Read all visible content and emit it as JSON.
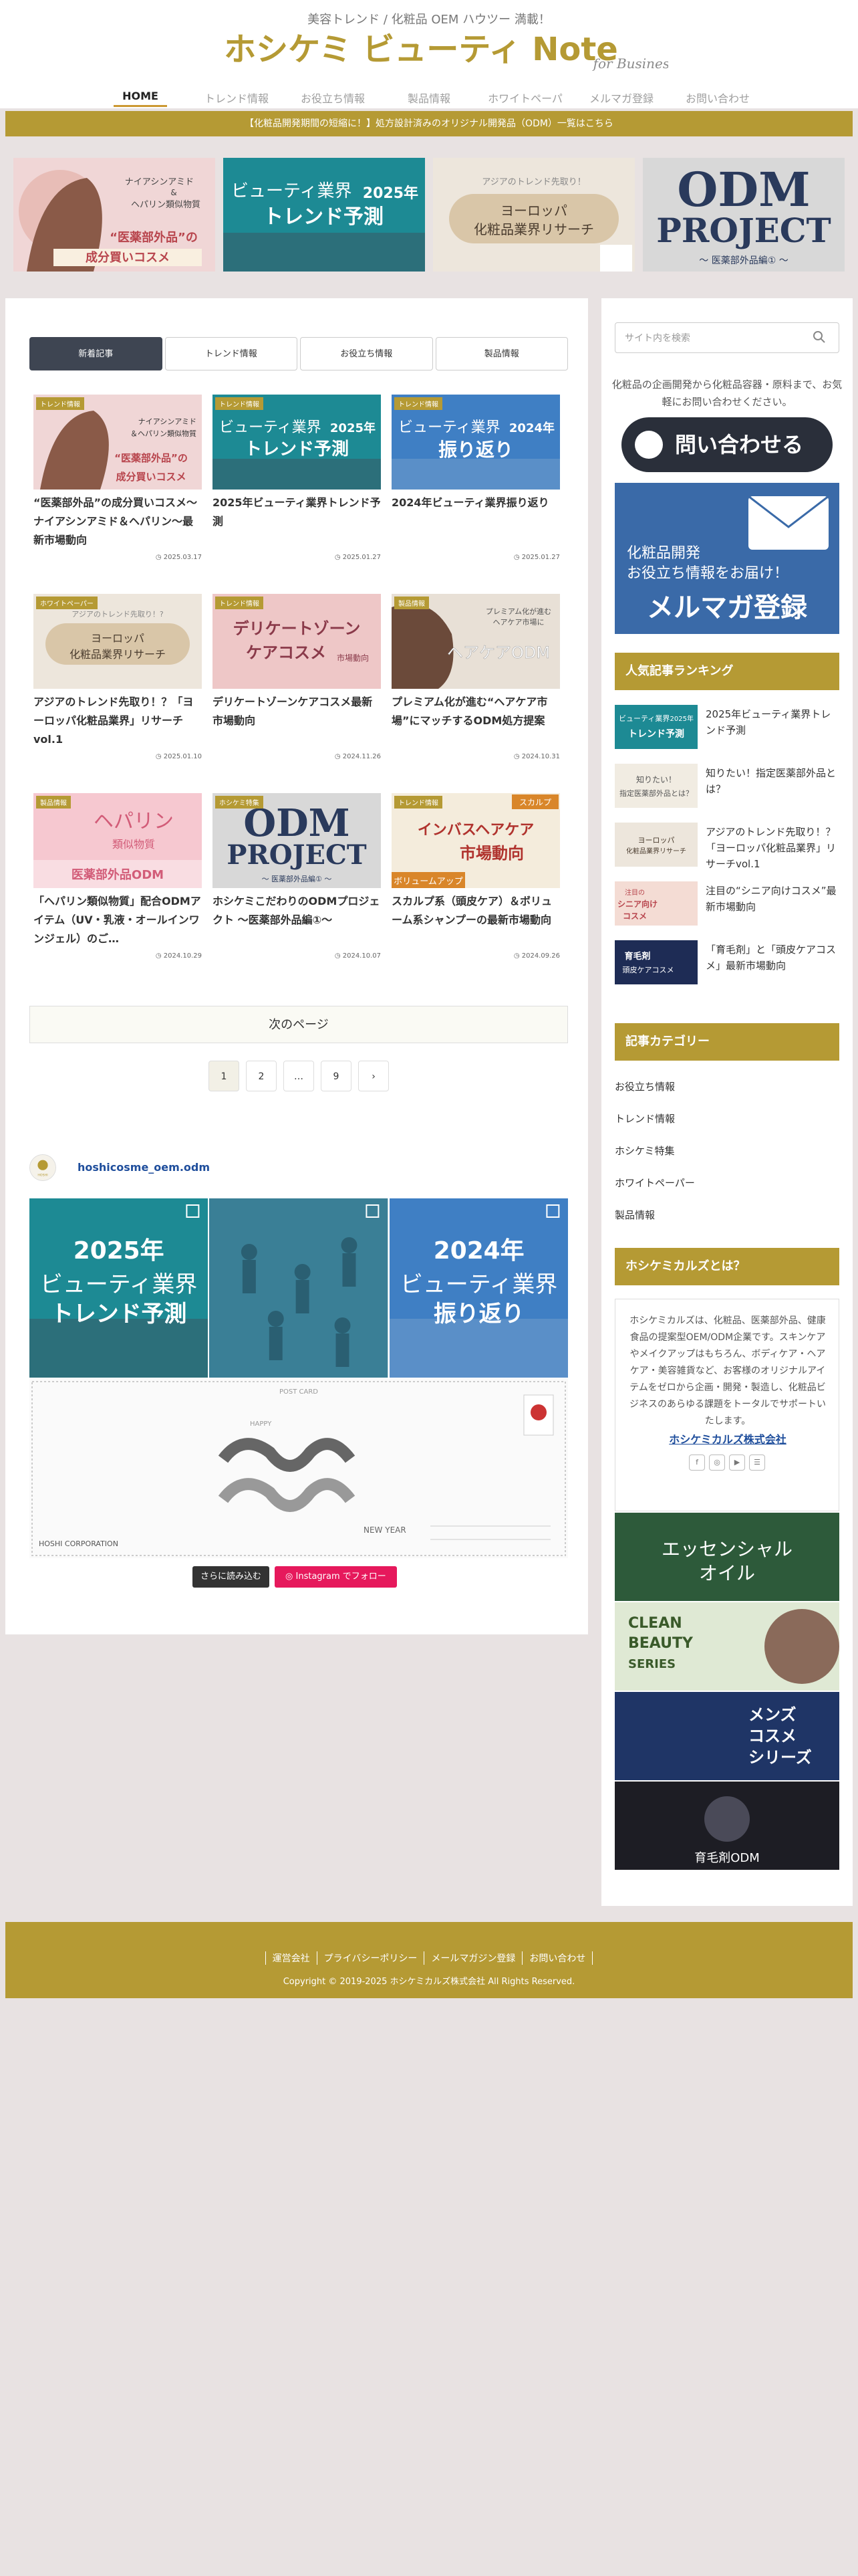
{
  "header": {
    "tagline": "美容トレンド / 化粧品 OEM ハウツー 満載！",
    "logo_main": "ホシケミ ビューティ Note",
    "logo_sub": "for Business"
  },
  "nav": [
    "HOME",
    "トレンド情報",
    "お役立ち情報",
    "製品情報",
    "ホワイトペーパー",
    "メルマガ登録",
    "お問い合わせ"
  ],
  "notice": "【化粧品開発期間の短縮に！】処方設計済みのオリジナル開発品（ODM）一覧はこちら",
  "carousel": [
    {
      "lines": [
        "ナイアシンアミド",
        "&",
        "ヘパリン類似物質",
        "“医薬部外品”の",
        "成分買いコスメ"
      ]
    },
    {
      "lines": [
        "ビューティ業界",
        "2025年",
        "トレンド予測"
      ]
    },
    {
      "lines": [
        "アジアのトレンド先取り！",
        "ヨーロッパ",
        "化粧品業界リサーチ"
      ]
    },
    {
      "lines": [
        "ODM",
        "PROJECT",
        "〜 医薬部外品編① 〜"
      ]
    }
  ],
  "tabs": [
    "新着記事",
    "トレンド情報",
    "お役立ち情報",
    "製品情報"
  ],
  "cards": [
    {
      "cat": "トレンド情報",
      "title": "“医薬部外品”の成分買いコスメ〜ナイアシンアミド＆ヘパリン〜最新市場動向",
      "date": "2025.03.17",
      "thumb": [
        "ナイアシンアミド",
        "＆ヘパリン類似物質",
        "“医薬部外品”の",
        "成分買いコスメ"
      ]
    },
    {
      "cat": "トレンド情報",
      "title": "2025年ビューティ業界トレンド予測",
      "date": "2025.01.27",
      "thumb": [
        "ビューティ業界",
        "2025年",
        "トレンド予測"
      ]
    },
    {
      "cat": "トレンド情報",
      "title": "2024年ビューティ業界振り返り",
      "date": "2025.01.27",
      "thumb": [
        "ビューティ業界",
        "2024年",
        "振り返り"
      ]
    },
    {
      "cat": "ホワイトペーパー",
      "title": "アジアのトレンド先取り！？「ヨーロッパ化粧品業界」リサーチvol.1",
      "date": "2025.01.10",
      "thumb": [
        "アジアのトレンド先取り！?",
        "ヨーロッパ",
        "化粧品業界リサーチ"
      ]
    },
    {
      "cat": "トレンド情報",
      "title": "デリケートゾーンケアコスメ最新市場動向",
      "date": "2024.11.26",
      "thumb": [
        "デリケートゾーン",
        "ケアコスメ",
        "市場動向"
      ]
    },
    {
      "cat": "製品情報",
      "title": "プレミアム化が進む“ヘアケア市場”にマッチするODM処方提案",
      "date": "2024.10.31",
      "thumb": [
        "プレミアム化が進む",
        "ヘアケア市場に",
        "ヘアケアODM"
      ]
    },
    {
      "cat": "製品情報",
      "title": "「ヘパリン類似物質」配合ODMアイテム（UV・乳液・オールインワンジェル）のご…",
      "date": "2024.10.29",
      "thumb": [
        "ヘパリン",
        "類似物質",
        "医薬部外品ODM"
      ]
    },
    {
      "cat": "ホシケミ特集",
      "title": "ホシケミこだわりのODMプロジェクト 〜医薬部外品編①〜",
      "date": "2024.10.07",
      "thumb": [
        "ODM",
        "PROJECT",
        "〜 医薬部外品編① 〜"
      ]
    },
    {
      "cat": "トレンド情報",
      "title": "スカルプ系（頭皮ケア）＆ボリューム系シャンプーの最新市場動向",
      "date": "2024.09.26",
      "thumb": [
        "スカルプ",
        "インバスヘアケア",
        "市場動向",
        "ボリュームアップ"
      ]
    }
  ],
  "pagination": {
    "next": "次のページ",
    "pages": [
      "1",
      "2",
      "…",
      "9"
    ],
    "next_arrow": "›"
  },
  "instagram": {
    "account": "hoshicosme_oem.odm",
    "avatar": "HOSHI",
    "more": "さらに読み込む",
    "follow": "Instagram でフォロー",
    "posts": [
      [
        "ビューティ業界",
        "2025年",
        "トレンド予測"
      ],
      [
        "",
        ""
      ],
      [
        "ビューティ業界",
        "2024年",
        "振り返り"
      ]
    ],
    "card": {
      "label": "POST CARD",
      "happy": "HAPPY",
      "new_year": "NEW\nYEAR",
      "corp": "HOSHI CORPORATION"
    }
  },
  "sidebar": {
    "search_placeholder": "サイト内を検索",
    "contact_text": "化粧品の企画開発から化粧品容器・原料まで、お気軽にお問い合わせください。",
    "contact_button": "問い合わせる",
    "mailmag": [
      "化粧品開発",
      "お役立ち情報をお届け！",
      "メルマガ登録"
    ],
    "ranking_head": "人気記事ランキング",
    "ranking": [
      {
        "title": "2025年ビューティ業界トレンド予測",
        "thumb": [
          "ビューティ業界",
          "2025年",
          "トレンド予測"
        ]
      },
      {
        "title": "知りたい！指定医薬部外品とは？",
        "thumb": [
          "知りたい！",
          "指定医薬部外品とは？"
        ]
      },
      {
        "title": "アジアのトレンド先取り！？「ヨーロッパ化粧品業界」リサーチvol.1",
        "thumb": [
          "ヨーロッパ",
          "化粧品業界リサーチ"
        ]
      },
      {
        "title": "注目の“シニア向けコスメ”最新市場動向",
        "thumb": [
          "注目の",
          "シニア向け",
          "コスメ"
        ]
      },
      {
        "title": "「育毛剤」と「頭皮ケアコスメ」最新市場動向",
        "thumb": [
          "育毛剤",
          "頭皮ケアコスメ"
        ]
      }
    ],
    "category_head": "記事カテゴリー",
    "categories": [
      "お役立ち情報",
      "トレンド情報",
      "ホシケミ特集",
      "ホワイトペーパー",
      "製品情報"
    ],
    "about_head": "ホシケミカルズとは？",
    "about_text": "ホシケミカルズは、化粧品、医薬部外品、健康食品の提案型OEM/ODM企業です。スキンケアやメイクアップはもちろん、ボディケア・ヘアケア・美容雑貨など、お客様のオリジナルアイテムをゼロから企画・開発・製造し、化粧品ビジネスのあらゆる課題をトータルでサポートいたします。",
    "about_link": "ホシケミカルズ株式会社",
    "social": [
      "f",
      "◎",
      "▶",
      "☰"
    ],
    "ads": [
      [
        "エッセンシャル",
        "オイル"
      ],
      [
        "CLEAN",
        "BEAUTY",
        "SERIES"
      ],
      [
        "メンズ",
        "コスメ",
        "シリーズ"
      ],
      [
        "育毛剤ODM"
      ]
    ]
  },
  "footer": {
    "links": [
      "運営会社",
      "プライバシーポリシー",
      "メールマガジン登録",
      "お問い合わせ"
    ],
    "copyright": "Copyright © 2019-2025 ホシケミカルズ株式会社 All Rights Reserved."
  },
  "colors": {
    "accent": "#b59a34",
    "nav_dark": "#3e4552",
    "teal": "#1d8a94",
    "blue": "#2f6fb3",
    "pink": "#e6195c",
    "link": "#1f4e9c"
  }
}
